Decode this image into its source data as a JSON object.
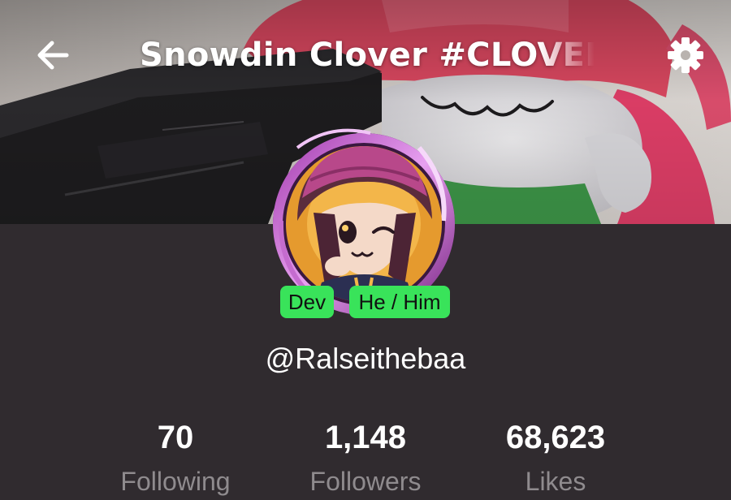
{
  "header": {
    "title": "Snowdin Clover #CLOVER",
    "back_icon": "arrow-left-icon",
    "settings_icon": "gear-icon"
  },
  "profile": {
    "badges": [
      {
        "label": "Dev",
        "color": "#39e35a"
      },
      {
        "label": "He / Him",
        "color": "#39e35a"
      }
    ],
    "username": "@Ralseithebaa"
  },
  "stats": [
    {
      "value": "70",
      "label": "Following"
    },
    {
      "value": "1,148",
      "label": "Followers"
    },
    {
      "value": "68,623",
      "label": "Likes"
    }
  ],
  "colors": {
    "background": "#302b2f",
    "badge": "#39e35a",
    "stat_label": "#8f8b8e",
    "text": "#ffffff"
  }
}
